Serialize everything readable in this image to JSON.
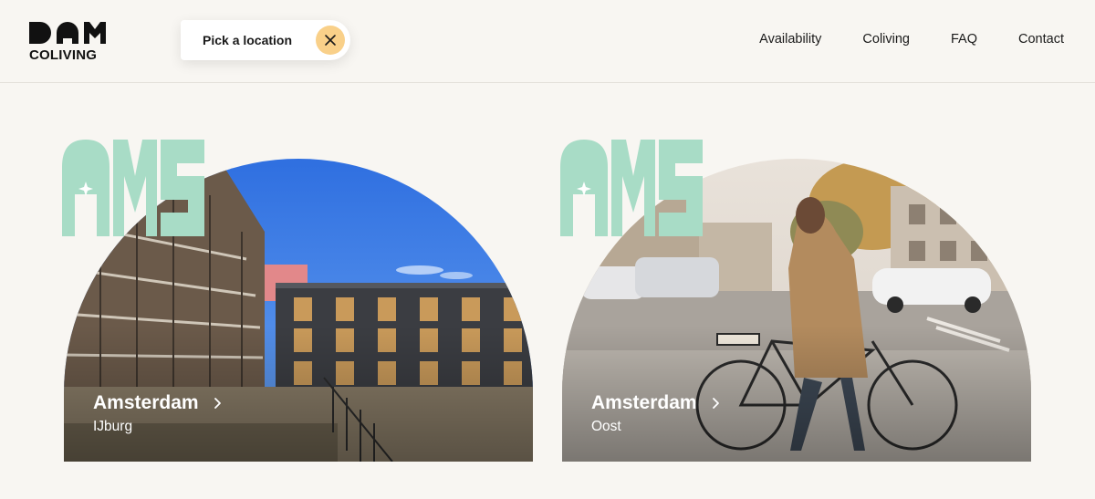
{
  "brand": {
    "logo_mark": "DAM",
    "logo_text": "COLIVING"
  },
  "location_picker": {
    "label": "Pick a location",
    "close_icon": "close-icon"
  },
  "nav": {
    "items": [
      "Availability",
      "Coliving",
      "FAQ",
      "Contact"
    ]
  },
  "cards": [
    {
      "city": "Amsterdam",
      "area": "IJburg",
      "badge_text": "AMS",
      "chevron_icon": "chevron-right-icon"
    },
    {
      "city": "Amsterdam",
      "area": "Oost",
      "badge_text": "AMS",
      "chevron_icon": "chevron-right-icon"
    }
  ],
  "colors": {
    "page_background": "#f8f6f2",
    "accent_yellow": "#f9d089",
    "ams_mint": "#a8dcc6",
    "text": "#1a1a1a"
  }
}
